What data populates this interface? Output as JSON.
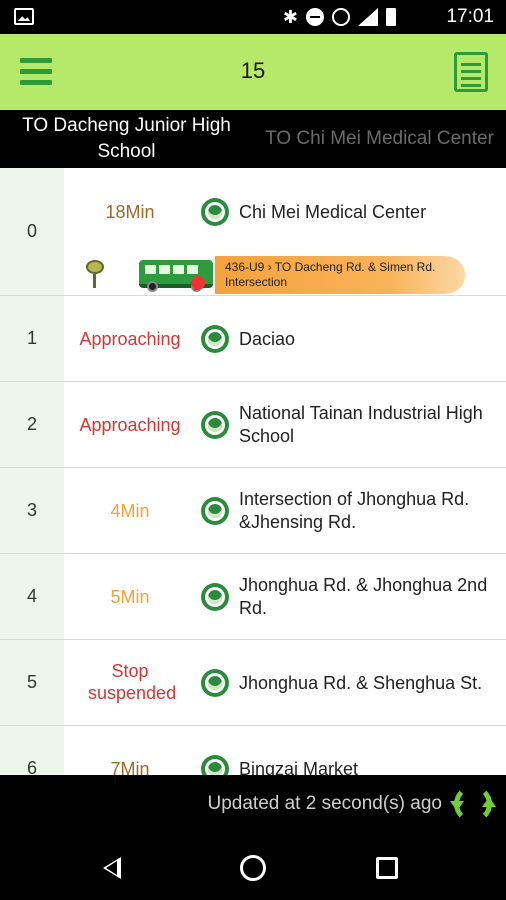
{
  "status_bar": {
    "time": "17:01"
  },
  "app_bar": {
    "title": "15"
  },
  "tabs": [
    {
      "label": "TO Dacheng Junior High School",
      "active": true
    },
    {
      "label": "TO Chi Mei Medical Center",
      "active": false
    }
  ],
  "stops": [
    {
      "index": "0",
      "eta": "18Min",
      "eta_color": "brown",
      "name": "Chi Mei Medical Center"
    },
    {
      "index": "1",
      "eta": "Approaching",
      "eta_color": "red",
      "name": "Daciao"
    },
    {
      "index": "2",
      "eta": "Approaching",
      "eta_color": "red",
      "name": "National Tainan Industrial High School"
    },
    {
      "index": "3",
      "eta": "4Min",
      "eta_color": "orange",
      "name": "Intersection of Jhonghua Rd. &Jhensing Rd."
    },
    {
      "index": "4",
      "eta": "5Min",
      "eta_color": "orange",
      "name": "Jhonghua Rd. & Jhonghua 2nd Rd."
    },
    {
      "index": "5",
      "eta": "Stop suspended",
      "eta_color": "red",
      "name": "Jhonghua Rd. & Shenghua St."
    },
    {
      "index": "6",
      "eta": "7Min",
      "eta_color": "brown",
      "name": "Bingzai Market"
    }
  ],
  "bus": {
    "plate": "436-U9",
    "text": "436-U9 › TO Dacheng Rd. & Simen Rd. Intersection"
  },
  "footer": {
    "updated_text": "Updated at 2 second(s) ago"
  },
  "colors": {
    "app_bar": "#b6e86a",
    "accent_green": "#2e9b3a",
    "red": "#d03838",
    "orange": "#eea43b",
    "brown": "#9b6a2a"
  }
}
